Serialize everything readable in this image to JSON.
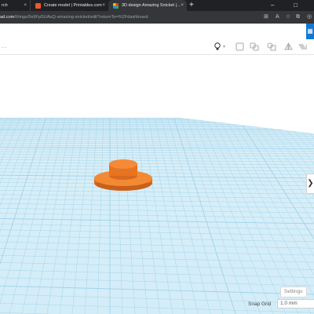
{
  "browser": {
    "tabs": [
      {
        "label": "rch",
        "close": "×"
      },
      {
        "label": "Create model | Printables.com",
        "close": "×",
        "favicon": "printables-icon"
      },
      {
        "label": "3D design Amazing Snicket | Ti",
        "close": "×",
        "favicon": "tinkercad-icon"
      }
    ],
    "new_tab": "+",
    "window_controls": {
      "minimize": "–",
      "maximize": "□"
    },
    "url_domain": "ad.com",
    "url_path": "/things/9s9FpSUAuQ-amazing-snicket/edit?returnTo=%2Fdashboard",
    "icons": [
      "tab-search-icon",
      "read-aloud-icon",
      "favorites-icon",
      "collections-icon",
      "browser-essentials-icon"
    ]
  },
  "app": {
    "grid_button_icon": "grid-icon",
    "toolbar": {
      "left_glyph": "…",
      "light_label": "▾",
      "icons": [
        "lightbulb-icon",
        "group-icon",
        "ungroup-icon",
        "align-icon",
        "mirror-icon",
        "flip-icon"
      ]
    },
    "workplane": {
      "grid_color": "#9fd3ea",
      "object_color": "#f07d25",
      "object": "cylinder-hat-shape"
    },
    "settings_label": "Settings",
    "snap_grid_label": "Snap Grid",
    "snap_grid_value": "1.0 mm",
    "side_arrow": "❯"
  }
}
